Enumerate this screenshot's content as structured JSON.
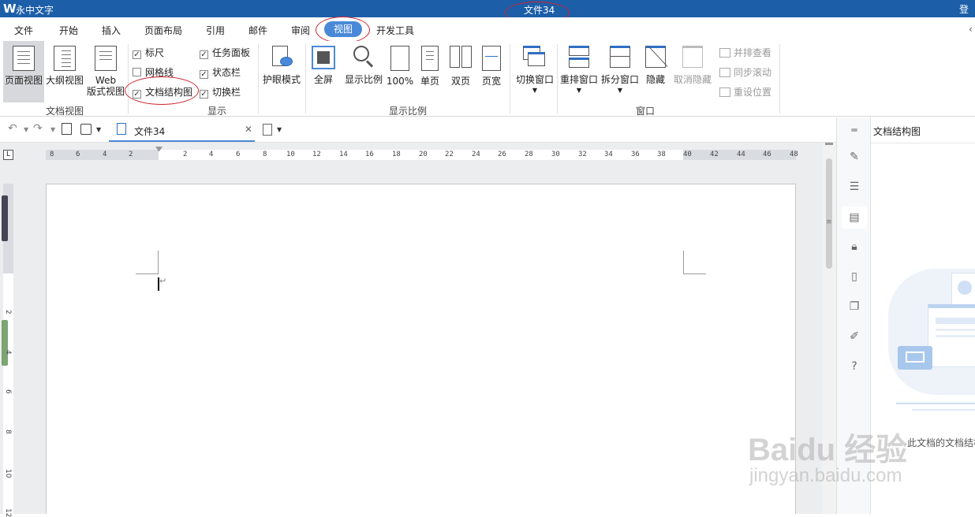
{
  "titlebar": {
    "app_name": "永中文字",
    "doc_title": "文件34",
    "login": "登录"
  },
  "menu": {
    "items": [
      "文件",
      "开始",
      "插入",
      "页面布局",
      "引用",
      "邮件",
      "审阅",
      "视图",
      "开发工具"
    ],
    "active": "视图"
  },
  "ribbon": {
    "doc_view": {
      "page_view": "页面视图",
      "outline_view": "大纲视图",
      "web_view_line1": "Web",
      "web_view_line2": "版式视图",
      "group_label": "文档视图"
    },
    "show": {
      "ruler": "标尺",
      "gridlines": "网格线",
      "doc_map": "文档结构图",
      "task_pane": "任务面板",
      "status_bar": "状态栏",
      "switch_bar": "切换栏",
      "group_label": "显示",
      "ruler_checked": true,
      "gridlines_checked": false,
      "doc_map_checked": true,
      "task_pane_checked": true,
      "status_bar_checked": true,
      "switch_bar_checked": true
    },
    "eye_mode": "护眼模式",
    "zoom": {
      "fullscreen": "全屏",
      "zoom_ratio": "显示比例",
      "hundred": "100%",
      "single_page": "单页",
      "two_pages": "双页",
      "page_width": "页宽",
      "group_label": "显示比例"
    },
    "window": {
      "switch_window": "切换窗口",
      "rearrange": "重排窗口",
      "split": "拆分窗口",
      "hide": "隐藏",
      "unhide": "取消隐藏",
      "side_by_side": "并排查看",
      "sync_scroll": "同步滚动",
      "reset_position": "重设位置",
      "group_label": "窗口"
    }
  },
  "tabstrip": {
    "doc_tab": "文件34"
  },
  "ruler": {
    "h_ticks": [
      "8",
      "6",
      "4",
      "2",
      "2",
      "4",
      "6",
      "8",
      "10",
      "12",
      "14",
      "16",
      "18",
      "20",
      "22",
      "24",
      "26",
      "28",
      "30",
      "32",
      "34",
      "36",
      "38",
      "40",
      "42",
      "44",
      "46",
      "48"
    ],
    "v_ticks": [
      "2",
      "4",
      "6",
      "8",
      "10",
      "12"
    ],
    "corner": "L"
  },
  "right_pane": {
    "title": "文档结构图",
    "empty_text": "此文档的文档结构，"
  },
  "watermark": {
    "line1": "Baidu 经验",
    "line2": "jingyan.baidu.com"
  },
  "colors": {
    "titlebar": "#1c5ea8",
    "active_tab": "#4a89d8",
    "annotation": "#d0242f"
  }
}
